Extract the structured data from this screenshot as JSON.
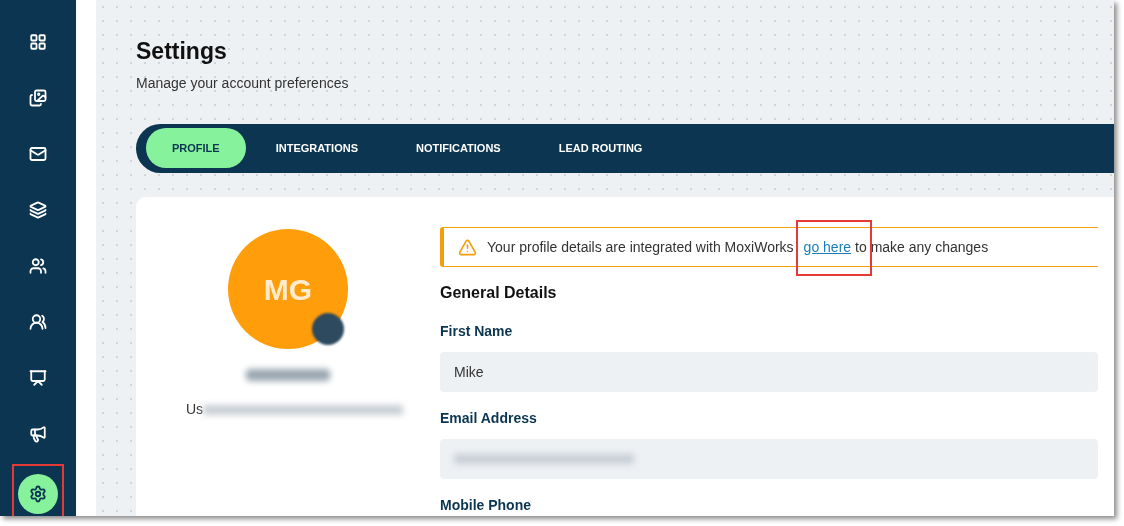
{
  "sidebar": {
    "items": [
      {
        "kind": "grid",
        "selected": false
      },
      {
        "kind": "images",
        "selected": false
      },
      {
        "kind": "mail",
        "selected": false
      },
      {
        "kind": "layers",
        "selected": false
      },
      {
        "kind": "users",
        "selected": false
      },
      {
        "kind": "group",
        "selected": false
      },
      {
        "kind": "presentation",
        "selected": false
      },
      {
        "kind": "megaphone",
        "selected": false
      },
      {
        "kind": "settings",
        "selected": true
      }
    ]
  },
  "header": {
    "title": "Settings",
    "subtitle": "Manage your account preferences"
  },
  "tabs": [
    {
      "label": "PROFILE",
      "selected": true
    },
    {
      "label": "INTEGRATIONS",
      "selected": false
    },
    {
      "label": "NOTIFICATIONS",
      "selected": false
    },
    {
      "label": "LEAD ROUTING",
      "selected": false
    }
  ],
  "profile": {
    "initials": "MG",
    "role_prefix": "Us"
  },
  "alert": {
    "text": "Your profile details are integrated with MoxiWorks",
    "link": "go here",
    "suffix": "to make any changes"
  },
  "section_title": "General Details",
  "fields": [
    {
      "label": "First Name",
      "kind": "text",
      "value": "Mike"
    },
    {
      "label": "Email Address",
      "kind": "redacted"
    },
    {
      "label": "Mobile Phone",
      "kind": "label"
    }
  ]
}
